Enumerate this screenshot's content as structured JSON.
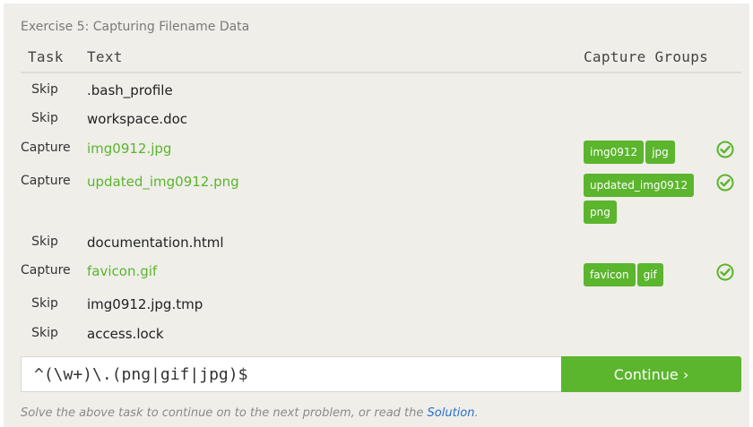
{
  "exercise_title": "Exercise 5: Capturing Filename Data",
  "headers": {
    "task": "Task",
    "text": "Text",
    "groups": "Capture Groups"
  },
  "rows": [
    {
      "task": "Skip",
      "text": ".bash_profile",
      "groups": [],
      "matched": false
    },
    {
      "task": "Skip",
      "text": "workspace.doc",
      "groups": [],
      "matched": false
    },
    {
      "task": "Capture",
      "text": "img0912.jpg",
      "groups": [
        "img0912",
        "jpg"
      ],
      "matched": true
    },
    {
      "task": "Capture",
      "text": "updated_img0912.png",
      "groups": [
        "updated_img0912",
        "png"
      ],
      "matched": true
    },
    {
      "task": "Skip",
      "text": "documentation.html",
      "groups": [],
      "matched": false
    },
    {
      "task": "Capture",
      "text": "favicon.gif",
      "groups": [
        "favicon",
        "gif"
      ],
      "matched": true
    },
    {
      "task": "Skip",
      "text": "img0912.jpg.tmp",
      "groups": [],
      "matched": false
    },
    {
      "task": "Skip",
      "text": "access.lock",
      "groups": [],
      "matched": false
    }
  ],
  "answer": {
    "value": "^(\\w+)\\.(png|gif|jpg)$"
  },
  "continue_label": "Continue ›",
  "footer": {
    "text": "Solve the above task to continue on to the next problem, or read the ",
    "link": "Solution",
    "suffix": "."
  },
  "colors": {
    "accent": "#5bb52d",
    "panel": "#efeee9",
    "link": "#2a6fcc"
  },
  "icons": {
    "check": "check-circle-icon"
  }
}
